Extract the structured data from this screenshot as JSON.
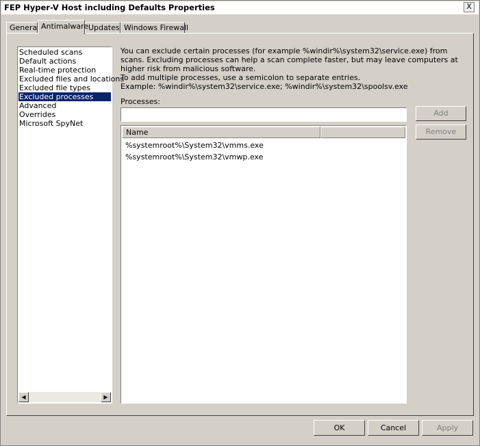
{
  "window": {
    "title": "FEP Hyper-V Host including Defaults Properties",
    "close_label": "X"
  },
  "tabs": [
    {
      "label": "General",
      "active": false
    },
    {
      "label": "Antimalware",
      "active": true
    },
    {
      "label": "Updates",
      "active": false
    },
    {
      "label": "Windows Firewall",
      "active": false
    }
  ],
  "nav": {
    "items": [
      {
        "label": "Scheduled scans"
      },
      {
        "label": "Default actions"
      },
      {
        "label": "Real-time protection"
      },
      {
        "label": "Excluded files and locations"
      },
      {
        "label": "Excluded file types"
      },
      {
        "label": "Excluded processes",
        "selected": true
      },
      {
        "label": "Advanced"
      },
      {
        "label": "Overrides"
      },
      {
        "label": "Microsoft SpyNet"
      }
    ],
    "scroll_left": "◀",
    "scroll_right": "▶"
  },
  "description": {
    "line1": "You can exclude certain processes (for example %windir%\\system32\\service.exe) from scans. Excluding processes can help a scan complete faster, but may leave computers at higher risk from malicious software.",
    "line2": "To add multiple processes, use a semicolon to separate entries.",
    "line3": "Example: %windir%\\system32\\service.exe; %windir%\\system32\\spoolsv.exe"
  },
  "processes": {
    "label": "Processes:",
    "value": "",
    "add_label": "Add",
    "remove_label": "Remove"
  },
  "list": {
    "columns": [
      "Name",
      ""
    ],
    "rows": [
      "%systemroot%\\System32\\vmms.exe",
      "%systemroot%\\System32\\vmwp.exe"
    ]
  },
  "footer": {
    "ok_label": "OK",
    "cancel_label": "Cancel",
    "apply_label": "Apply"
  }
}
